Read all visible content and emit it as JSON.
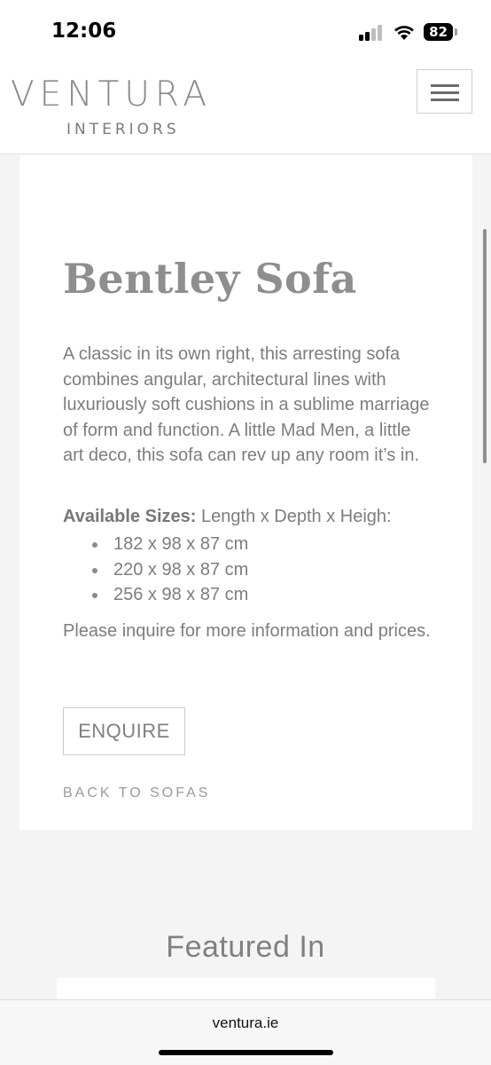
{
  "status_bar": {
    "time": "12:06",
    "battery_level": "82",
    "icons": [
      "signal-icon",
      "wifi-icon",
      "battery-icon"
    ]
  },
  "header": {
    "logo_main": "VENTURA",
    "logo_sub": "INTERIORS",
    "menu_icon": "hamburger-icon"
  },
  "product": {
    "title": "Bentley Sofa",
    "description": "A classic in its own right, this arresting sofa combines angular, architectural lines with luxuriously soft cushions in a sublime marriage of form and function. A little Mad Men, a little art deco, this sofa can rev up any room it’s in.",
    "sizes_label": "Available Sizes:",
    "sizes_dimensions": "Length x Depth x Heigh:",
    "sizes": [
      "182 x 98 x 87 cm",
      "220 x 98 x 87 cm",
      "256 x 98 x 87 cm"
    ],
    "inquire_text": "Please inquire for more information and prices.",
    "enquire_label": "ENQUIRE",
    "back_link": "BACK TO SOFAS"
  },
  "featured": {
    "heading": "Featured In"
  },
  "browser": {
    "url": "ventura.ie"
  },
  "colors": {
    "text": "#7d7d7d",
    "background": "#f4f4f4",
    "card": "#ffffff"
  }
}
